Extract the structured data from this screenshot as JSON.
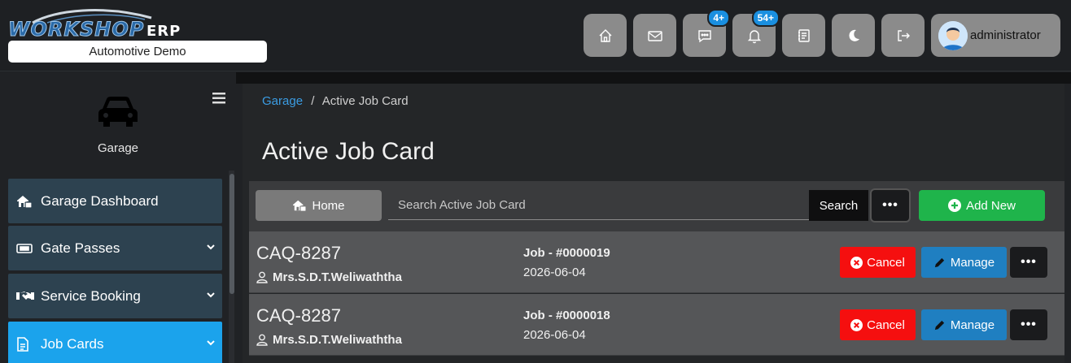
{
  "header": {
    "logo_main": "WORKSHOP",
    "logo_erp": "ERP",
    "company": "Automotive Demo",
    "icons": [
      "home-icon",
      "mail-icon",
      "chat-icon",
      "bell-icon",
      "notebook-icon",
      "moon-icon",
      "logout-icon"
    ],
    "chat_badge": "4+",
    "bell_badge": "54+",
    "username": "administrator"
  },
  "sidebar": {
    "module_label": "Garage",
    "items": [
      {
        "label": "Garage Dashboard",
        "icon": "garage-dashboard-icon"
      },
      {
        "label": "Gate Passes",
        "icon": "ticket-icon"
      },
      {
        "label": "Service Booking",
        "icon": "handshake-icon"
      },
      {
        "label": "Job Cards",
        "icon": "document-icon"
      }
    ]
  },
  "main": {
    "breadcrumb_root": "Garage",
    "breadcrumb_sep": "/",
    "breadcrumb_current": "Active Job Card",
    "title": "Active Job Card",
    "toolbar": {
      "home_label": "Home",
      "search_placeholder": "Search Active Job Card",
      "search_label": "Search",
      "more_label": "•••",
      "add_label": "Add New"
    },
    "rows": [
      {
        "plate": "CAQ-8287",
        "customer": "Mrs.S.D.T.Weliwaththa",
        "job": "Job - #0000019",
        "date": "2026-06-04",
        "cancel": "Cancel",
        "manage": "Manage",
        "more": "•••"
      },
      {
        "plate": "CAQ-8287",
        "customer": "Mrs.S.D.T.Weliwaththa",
        "job": "Job - #0000018",
        "date": "2026-06-04",
        "cancel": "Cancel",
        "manage": "Manage",
        "more": "•••"
      }
    ]
  },
  "colors": {
    "active_nav": "#1ba3ec",
    "nav": "#2d4250",
    "add": "#1fb44b",
    "cancel": "#f50f0f",
    "manage": "#1f7fc1",
    "badge": "#1a8fe0"
  }
}
